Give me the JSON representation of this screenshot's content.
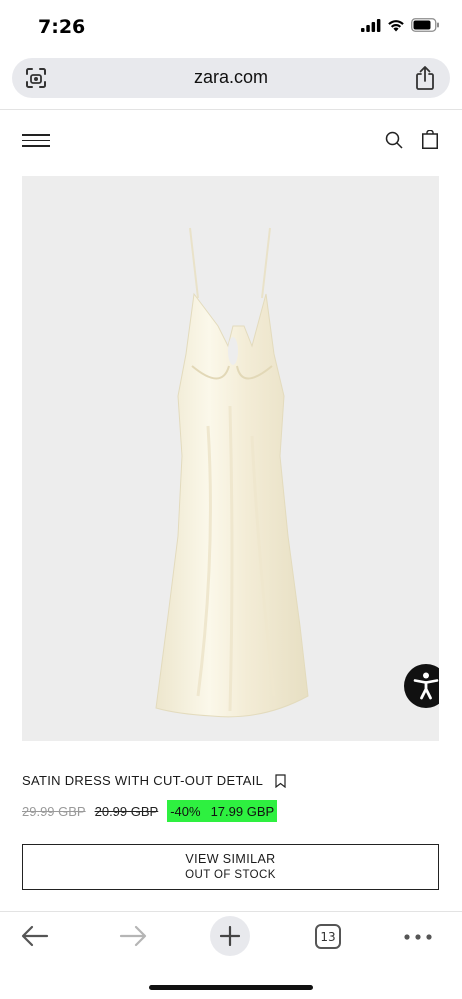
{
  "status_bar": {
    "time": "7:26"
  },
  "browser": {
    "url": "zara.com",
    "open_tabs_count": "13"
  },
  "site_header": {
    "menu_icon": "hamburger-icon",
    "search_icon": "search-icon",
    "bag_icon": "shopping-bag-icon"
  },
  "product": {
    "name": "SATIN DRESS WITH CUT-OUT DETAIL",
    "original_price": "29.99 GBP",
    "previous_price": "20.99 GBP",
    "discount": "-40%",
    "sale_price": "17.99 GBP",
    "image_description_icon": "dress-image",
    "colors": {
      "sale_highlight": "#2ef040",
      "image_bg": "#ededed",
      "dress": "#f6f1df"
    }
  },
  "actions": {
    "view_similar_label": "VIEW SIMILAR",
    "stock_status": "OUT OF STOCK"
  }
}
